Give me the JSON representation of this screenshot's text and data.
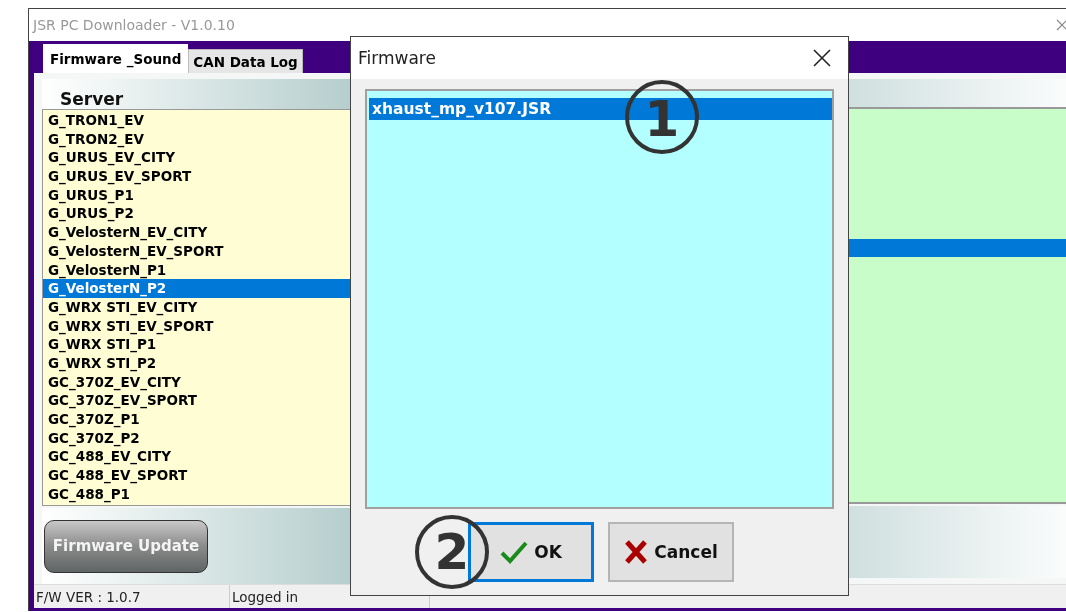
{
  "window": {
    "title": "JSR PC Downloader - V1.0.10"
  },
  "tabs": [
    {
      "label": "Firmware _Sound",
      "selected": true
    },
    {
      "label": "CAN Data Log",
      "selected": false
    }
  ],
  "server_list": {
    "heading": "Server",
    "items": [
      {
        "label": "G_TRON1_EV",
        "selected": false
      },
      {
        "label": "G_TRON2_EV",
        "selected": false
      },
      {
        "label": "G_URUS_EV_CITY",
        "selected": false
      },
      {
        "label": "G_URUS_EV_SPORT",
        "selected": false
      },
      {
        "label": "G_URUS_P1",
        "selected": false
      },
      {
        "label": "G_URUS_P2",
        "selected": false
      },
      {
        "label": "G_VelosterN_EV_CITY",
        "selected": false
      },
      {
        "label": "G_VelosterN_EV_SPORT",
        "selected": false
      },
      {
        "label": "G_VelosterN_P1",
        "selected": false
      },
      {
        "label": "G_VelosterN_P2",
        "selected": true
      },
      {
        "label": "G_WRX STI_EV_CITY",
        "selected": false
      },
      {
        "label": "G_WRX STI_EV_SPORT",
        "selected": false
      },
      {
        "label": "G_WRX STI_P1",
        "selected": false
      },
      {
        "label": "G_WRX STI_P2",
        "selected": false
      },
      {
        "label": "GC_370Z_EV_CITY",
        "selected": false
      },
      {
        "label": "GC_370Z_EV_SPORT",
        "selected": false
      },
      {
        "label": "GC_370Z_P1",
        "selected": false
      },
      {
        "label": "GC_370Z_P2",
        "selected": false
      },
      {
        "label": "GC_488_EV_CITY",
        "selected": false
      },
      {
        "label": "GC_488_EV_SPORT",
        "selected": false
      },
      {
        "label": "GC_488_P1",
        "selected": false
      }
    ]
  },
  "update_button": {
    "label": "Firmware Update"
  },
  "status_bar": [
    "F/W VER : 1.0.7",
    "Logged in"
  ],
  "dialog": {
    "title": "Firmware",
    "items": [
      {
        "label": "xhaust_mp_v107.JSR",
        "selected": true
      }
    ],
    "buttons": [
      {
        "label": "OK",
        "kind": "ok",
        "focused": true
      },
      {
        "label": "Cancel",
        "kind": "cancel",
        "focused": false
      }
    ]
  },
  "callouts": [
    {
      "label": "1"
    },
    {
      "label": "2"
    }
  ]
}
